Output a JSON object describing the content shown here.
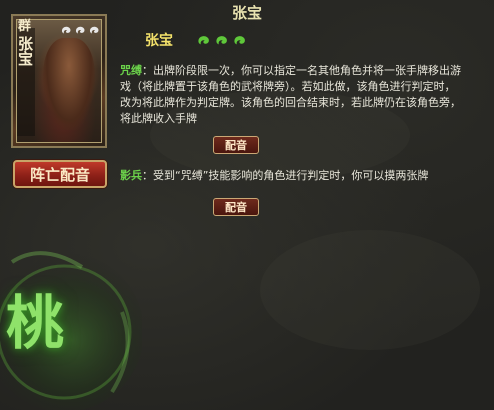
{
  "hero": {
    "title": "张宝",
    "name": "张宝",
    "faction_glyph": "群",
    "card_name_glyphs": "张宝",
    "hp": 3
  },
  "buttons": {
    "death_voice": "阵亡配音",
    "voice_1": "配音",
    "voice_2": "配音"
  },
  "skills": [
    {
      "name": "咒缚",
      "desc": "出牌阶段限一次，你可以指定一名其他角色并将一张手牌移出游戏（将此牌置于该角色的武将牌旁）。若如此做，该角色进行判定时，改为将此牌作为判定牌。该角色的回合结束时，若此牌仍在该角色旁，将此牌收入手牌"
    },
    {
      "name": "影兵",
      "desc": "受到“咒缚”技能影响的角色进行判定时，你可以摸两张牌"
    }
  ],
  "decor": {
    "emblem_glyph": "桃"
  },
  "colors": {
    "skill_name": "#6bd14a",
    "hero_name": "#f3e16a",
    "hp_magatama": "#5fc83a",
    "death_button": "#a82a1e"
  }
}
